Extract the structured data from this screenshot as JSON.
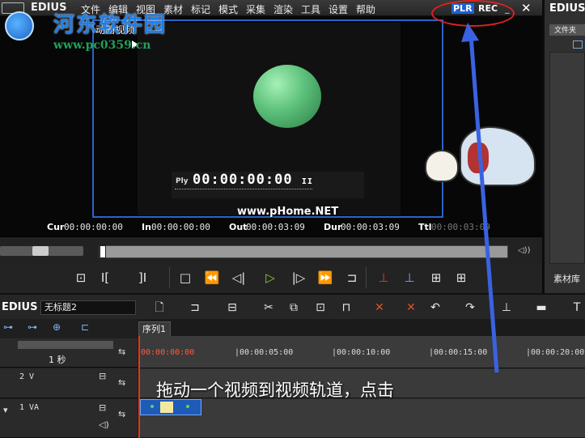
{
  "watermark": {
    "site_name": "河东软件园",
    "site_url": "www.pc0359.cn",
    "home_watermark": "www.pHome.NET"
  },
  "app": {
    "title": "EDIUS",
    "menu": [
      "文件",
      "编辑",
      "视图",
      "素材",
      "标记",
      "模式",
      "采集",
      "渲染",
      "工具",
      "设置",
      "帮助"
    ],
    "plr_label": "PLR",
    "rec_label": "REC",
    "minimize_glyph": "_",
    "close_glyph": "✕"
  },
  "preview": {
    "frame_label": "动画视频",
    "ply_label": "Ply",
    "ply_timecode": "00:00:00:00",
    "pause_glyph": "II",
    "cur_label": "Cur",
    "cur_value": "00:00:00:00",
    "in_label": "In",
    "in_value": "00:00:00:00",
    "out_label": "Out",
    "out_value": "00:00:03:09",
    "dur_label": "Dur",
    "dur_value": "00:00:03:09",
    "ttl_label": "Ttl",
    "ttl_value": "00:00:03:09"
  },
  "bin_panel": {
    "title": "EDIUS",
    "tab": "文件夹",
    "footer": "素材库"
  },
  "timeline": {
    "app_title": "EDIUS",
    "project_name": "无标题2",
    "sequence_tab": "序列1",
    "scale_label": "1 秒",
    "ruler": [
      "00:00:00:00",
      "|00:00:05:00",
      "|00:00:10:00",
      "|00:00:15:00",
      "|00:00:20:00"
    ],
    "tracks": [
      {
        "name": "2 V"
      },
      {
        "name": "1 VA"
      }
    ]
  },
  "instruction_overlay": "拖动一个视频到视频轨道，点击",
  "colors": {
    "accent_blue": "#2a64c8",
    "play_green": "#8ed13a",
    "playhead_red": "#e03a1a",
    "annotation_red": "#e02020"
  }
}
